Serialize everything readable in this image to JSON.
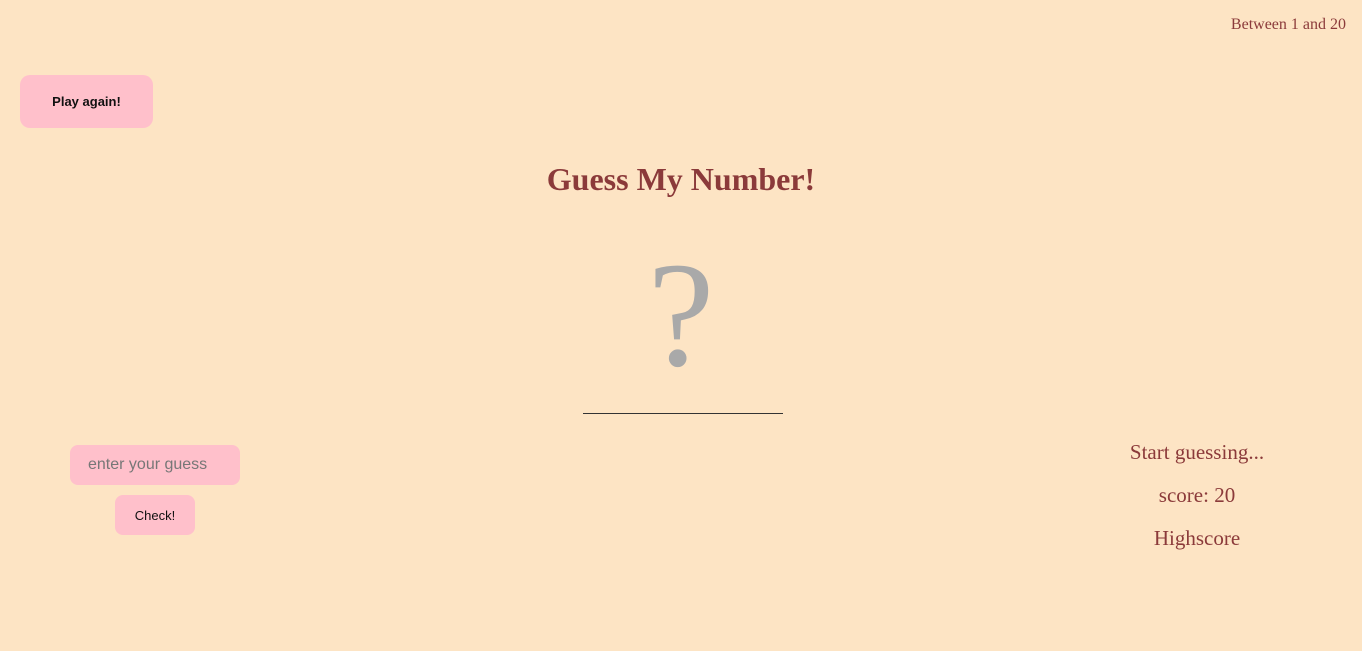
{
  "header": {
    "range_text": "Between 1 and 20"
  },
  "controls": {
    "play_again_label": "Play again!",
    "guess_placeholder": "enter your guess",
    "guess_value": "",
    "check_label": "Check!"
  },
  "game": {
    "title": "Guess My Number!",
    "secret_display": "?"
  },
  "stats": {
    "message": "Start guessing...",
    "score_text": "score: 20",
    "highscore_text": "Highscore"
  },
  "colors": {
    "background": "#fde4c4",
    "button": "#ffc0cb",
    "text": "#8b3a3a",
    "secret": "#a9a9a9"
  }
}
